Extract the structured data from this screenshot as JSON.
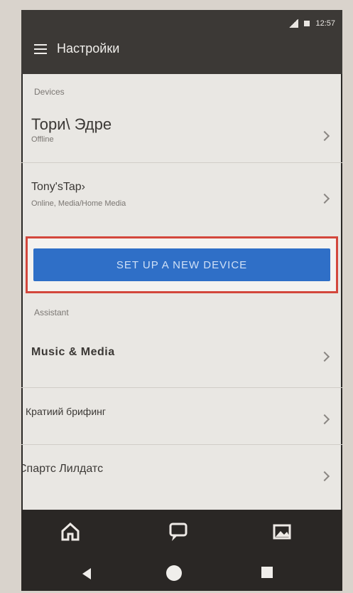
{
  "status": {
    "time": "12:57"
  },
  "appbar": {
    "title": "Настройки"
  },
  "sections": {
    "devices_header": "Devices",
    "assistant_header": "Assistant"
  },
  "rows": [
    {
      "title": "Тори\\ Эдре",
      "subtitle": "Offline"
    },
    {
      "title": "Tony'sTap›",
      "subtitle": "Online, Media/Home Media"
    },
    {
      "title": "Music & Media",
      "subtitle": ""
    },
    {
      "title": "Кратиий брифинг",
      "subtitle": ""
    },
    {
      "title": "Спартс Лилдатс",
      "subtitle": ""
    }
  ],
  "cta": {
    "label": "SET UP A NEW DEVICE"
  },
  "bottom_nav": {
    "icons": [
      "home-icon",
      "chat-icon",
      "photo-icon"
    ]
  },
  "colors": {
    "accent": "#2f6fc7",
    "highlight_border": "#d3473c",
    "topbar": "#3c3936",
    "background": "#e9e7e3"
  }
}
